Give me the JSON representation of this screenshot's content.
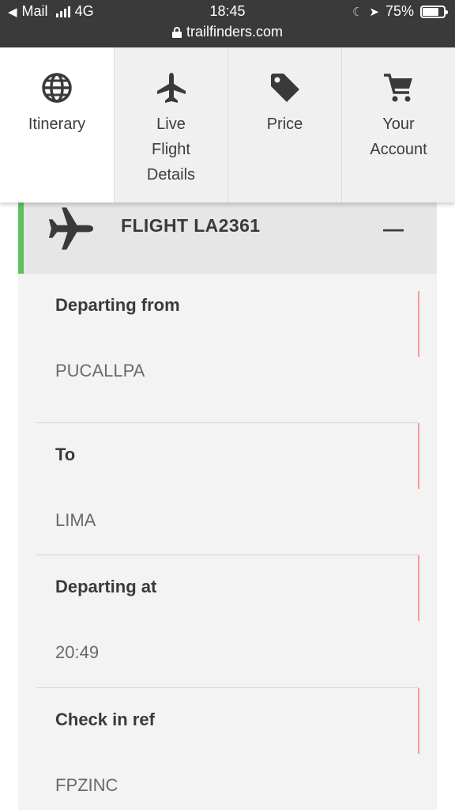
{
  "status_bar": {
    "back_app": "Mail",
    "network": "4G",
    "time": "18:45",
    "battery": "75%",
    "battery_level": 0.75,
    "url": "trailfinders.com"
  },
  "nav": {
    "tabs": [
      {
        "label": "Itinerary",
        "icon": "globe-icon"
      },
      {
        "label": "Live Flight Details",
        "icon": "airplane-icon"
      },
      {
        "label": "Price",
        "icon": "price-tag-icon"
      },
      {
        "label": "Your Account",
        "icon": "cart-icon"
      }
    ]
  },
  "flight": {
    "title": "FLIGHT LA2361",
    "collapse_symbol": "—",
    "accent_color": "#5fc05d",
    "rows": [
      {
        "label": "Departing from",
        "value": "PUCALLPA"
      },
      {
        "label": "To",
        "value": "LIMA"
      },
      {
        "label": "Departing at",
        "value": "20:49"
      },
      {
        "label": "Check in ref",
        "value": "FPZINC"
      }
    ]
  }
}
